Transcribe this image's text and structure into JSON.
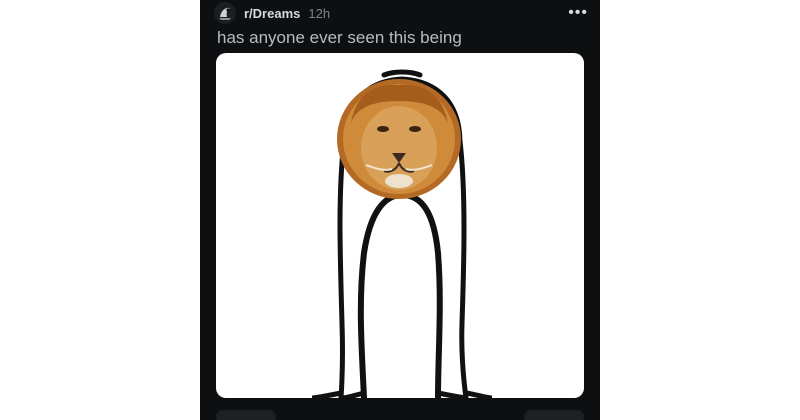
{
  "post": {
    "subreddit": "r/Dreams",
    "time_ago": "12h",
    "title": "has anyone ever seen this being",
    "more_label": "•••"
  },
  "colors": {
    "background": "#0e0f11",
    "media_bg": "#ffffff",
    "text_primary": "#d7dadc",
    "text_secondary": "#818384"
  },
  "icons": {
    "avatar": "subreddit-avatar-icon",
    "more": "more-options-icon"
  },
  "media": {
    "description_icon": "lion-head-stick-figure-drawing"
  }
}
